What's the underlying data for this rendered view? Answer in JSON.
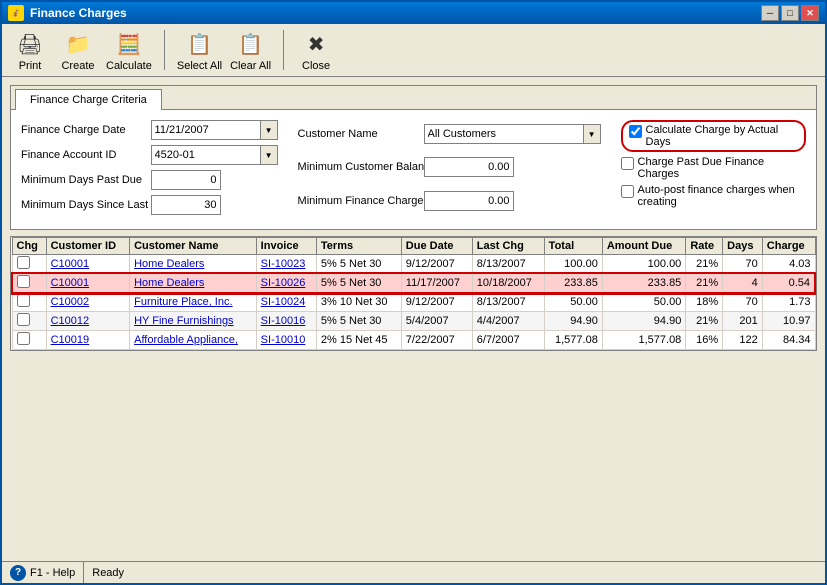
{
  "window": {
    "title": "Finance Charges",
    "title_icon": "💰"
  },
  "toolbar": {
    "buttons": [
      {
        "id": "print",
        "label": "Print",
        "icon": "🖨"
      },
      {
        "id": "create",
        "label": "Create",
        "icon": "📁"
      },
      {
        "id": "calculate",
        "label": "Calculate",
        "icon": "🧮"
      },
      {
        "id": "select_all",
        "label": "Select All",
        "icon": "📋"
      },
      {
        "id": "clear_all",
        "label": "Clear All",
        "icon": "📋"
      },
      {
        "id": "close",
        "label": "Close",
        "icon": "✖"
      }
    ]
  },
  "tab": {
    "label": "Finance Charge Criteria"
  },
  "form": {
    "finance_charge_date_label": "Finance Charge Date",
    "finance_charge_date_value": "11/21/2007",
    "finance_account_id_label": "Finance Account ID",
    "finance_account_id_value": "4520-01",
    "min_days_past_due_label": "Minimum Days Past Due",
    "min_days_past_due_value": "0",
    "min_days_since_label": "Minimum Days Since Last Charge",
    "min_days_since_value": "30",
    "customer_name_label": "Customer Name",
    "customer_name_value": "All Customers",
    "min_customer_balance_label": "Minimum Customer Balance",
    "min_customer_balance_value": "0.00",
    "min_finance_charge_label": "Minimum Finance Charge",
    "min_finance_charge_value": "0.00",
    "calc_by_actual_days_label": "Calculate Charge by Actual Days",
    "calc_by_actual_days_checked": true,
    "charge_past_due_label": "Charge Past Due Finance Charges",
    "charge_past_due_checked": false,
    "auto_post_label": "Auto-post finance charges when creating",
    "auto_post_checked": false
  },
  "table": {
    "columns": [
      "Chg",
      "Customer ID",
      "Customer Name",
      "Invoice",
      "Terms",
      "Due Date",
      "Last Chg",
      "Total",
      "Amount Due",
      "Rate",
      "Days",
      "Charge"
    ],
    "rows": [
      {
        "chg": false,
        "customer_id": "C10001",
        "customer_name": "Home Dealers",
        "invoice": "SI-10023",
        "terms": "5% 5 Net 30",
        "due_date": "9/12/2007",
        "last_chg": "8/13/2007",
        "total": "100.00",
        "amount_due": "100.00",
        "rate": "21%",
        "days": "70",
        "charge": "4.03",
        "selected": false
      },
      {
        "chg": false,
        "customer_id": "C10001",
        "customer_name": "Home Dealers",
        "invoice": "SI-10026",
        "terms": "5% 5 Net 30",
        "due_date": "11/17/2007",
        "last_chg": "10/18/2007",
        "total": "233.85",
        "amount_due": "233.85",
        "rate": "21%",
        "days": "4",
        "charge": "0.54",
        "selected": true
      },
      {
        "chg": false,
        "customer_id": "C10002",
        "customer_name": "Furniture Place, Inc.",
        "invoice": "SI-10024",
        "terms": "3% 10 Net 30",
        "due_date": "9/12/2007",
        "last_chg": "8/13/2007",
        "total": "50.00",
        "amount_due": "50.00",
        "rate": "18%",
        "days": "70",
        "charge": "1.73",
        "selected": false
      },
      {
        "chg": false,
        "customer_id": "C10012",
        "customer_name": "HY Fine Furnishings",
        "invoice": "SI-10016",
        "terms": "5% 5 Net 30",
        "due_date": "5/4/2007",
        "last_chg": "4/4/2007",
        "total": "94.90",
        "amount_due": "94.90",
        "rate": "21%",
        "days": "201",
        "charge": "10.97",
        "selected": false
      },
      {
        "chg": false,
        "customer_id": "C10019",
        "customer_name": "Affordable Appliance,",
        "invoice": "SI-10010",
        "terms": "2% 15 Net 45",
        "due_date": "7/22/2007",
        "last_chg": "6/7/2007",
        "total": "1,577.08",
        "amount_due": "1,577.08",
        "rate": "16%",
        "days": "122",
        "charge": "84.34",
        "selected": false
      }
    ]
  },
  "status_bar": {
    "help_label": "F1 - Help",
    "status_text": "Ready"
  },
  "title_controls": {
    "minimize": "─",
    "maximize": "□",
    "close": "✕"
  }
}
